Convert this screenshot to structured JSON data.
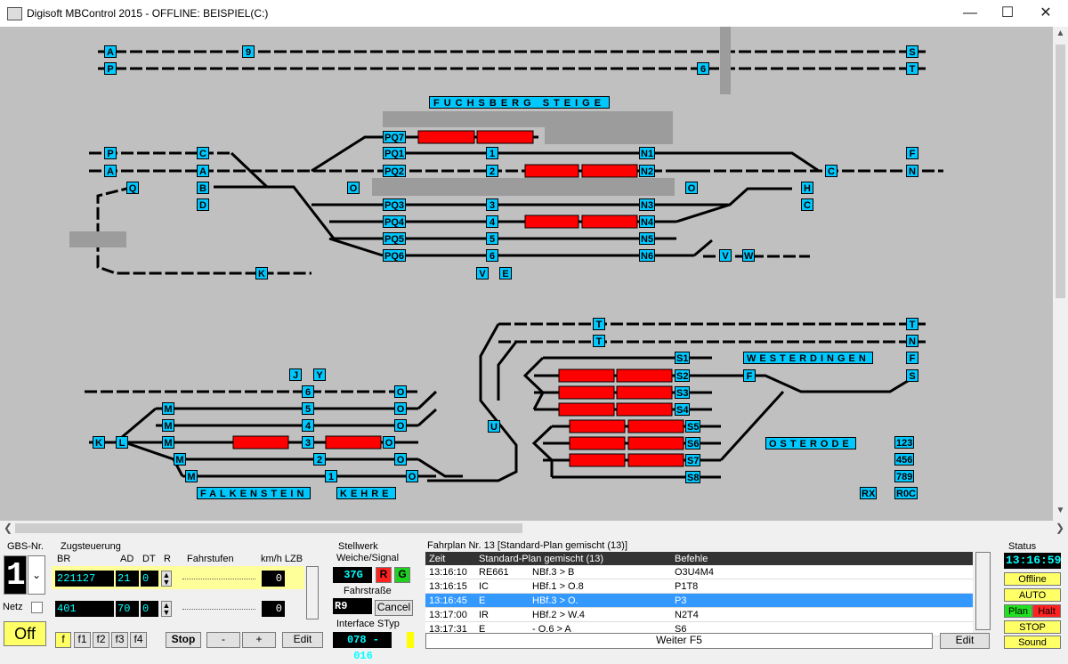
{
  "window": {
    "title": "Digisoft MBControl 2015 - OFFLINE: BEISPIEL(C:)"
  },
  "stations": {
    "s1": "FUCHSBERG STEIGE",
    "s2": "WESTERDINGEN",
    "s3": "OSTERODE",
    "s4": "FALKENSTEIN",
    "s4b": "KEHRE"
  },
  "labels": [
    {
      "id": "A",
      "t": "A"
    },
    {
      "id": "P",
      "t": "P"
    },
    {
      "id": "9",
      "t": "9"
    },
    {
      "id": "6",
      "t": "6"
    },
    {
      "id": "S",
      "t": "S"
    },
    {
      "id": "T",
      "t": "T"
    },
    {
      "id": "P2",
      "t": "P"
    },
    {
      "id": "A2",
      "t": "A"
    },
    {
      "id": "C1",
      "t": "C"
    },
    {
      "id": "A3",
      "t": "A"
    },
    {
      "id": "Q",
      "t": "Q"
    },
    {
      "id": "B",
      "t": "B"
    },
    {
      "id": "D",
      "t": "D"
    },
    {
      "id": "PQ7",
      "t": "PQ7"
    },
    {
      "id": "PQ1",
      "t": "PQ1"
    },
    {
      "id": "PQ2",
      "t": "PQ2"
    },
    {
      "id": "PQ3",
      "t": "PQ3"
    },
    {
      "id": "PQ4",
      "t": "PQ4"
    },
    {
      "id": "PQ5",
      "t": "PQ5"
    },
    {
      "id": "PQ6",
      "t": "PQ6"
    },
    {
      "id": "O1",
      "t": "O"
    },
    {
      "id": "O2",
      "t": "O"
    },
    {
      "id": "N1",
      "t": "N1"
    },
    {
      "id": "N2",
      "t": "N2"
    },
    {
      "id": "N3",
      "t": "N3"
    },
    {
      "id": "N4",
      "t": "N4"
    },
    {
      "id": "N5",
      "t": "N5"
    },
    {
      "id": "N6",
      "t": "N6"
    },
    {
      "id": "n1",
      "t": "1"
    },
    {
      "id": "n2",
      "t": "2"
    },
    {
      "id": "n3",
      "t": "3"
    },
    {
      "id": "n4",
      "t": "4"
    },
    {
      "id": "n5",
      "t": "5"
    },
    {
      "id": "n6",
      "t": "6"
    },
    {
      "id": "F1",
      "t": "F"
    },
    {
      "id": "N",
      "t": "N"
    },
    {
      "id": "C2",
      "t": "C"
    },
    {
      "id": "H",
      "t": "H"
    },
    {
      "id": "C3",
      "t": "C"
    },
    {
      "id": "V",
      "t": "V"
    },
    {
      "id": "W",
      "t": "W"
    },
    {
      "id": "E",
      "t": "E"
    },
    {
      "id": "V2",
      "t": "V"
    },
    {
      "id": "K",
      "t": "K"
    },
    {
      "id": "T2",
      "t": "T"
    },
    {
      "id": "T3",
      "t": "T"
    },
    {
      "id": "T4",
      "t": "T"
    },
    {
      "id": "N7",
      "t": "N"
    },
    {
      "id": "F2",
      "t": "F"
    },
    {
      "id": "S2",
      "t": "S"
    },
    {
      "id": "S_1",
      "t": "S1"
    },
    {
      "id": "S_2",
      "t": "S2"
    },
    {
      "id": "S_3",
      "t": "S3"
    },
    {
      "id": "S_4",
      "t": "S4"
    },
    {
      "id": "S_5",
      "t": "S5"
    },
    {
      "id": "S_6",
      "t": "S6"
    },
    {
      "id": "S_7",
      "t": "S7"
    },
    {
      "id": "S_8",
      "t": "S8"
    },
    {
      "id": "F3",
      "t": "F"
    },
    {
      "id": "U",
      "t": "U"
    },
    {
      "id": "J",
      "t": "J"
    },
    {
      "id": "Y",
      "t": "Y"
    },
    {
      "id": "f6",
      "t": "6"
    },
    {
      "id": "f5",
      "t": "5"
    },
    {
      "id": "f4",
      "t": "4"
    },
    {
      "id": "f3",
      "t": "3"
    },
    {
      "id": "f2",
      "t": "2"
    },
    {
      "id": "f1",
      "t": "1"
    },
    {
      "id": "M1",
      "t": "M"
    },
    {
      "id": "M2",
      "t": "M"
    },
    {
      "id": "M3",
      "t": "M"
    },
    {
      "id": "M4",
      "t": "M"
    },
    {
      "id": "M5",
      "t": "M"
    },
    {
      "id": "Ok1",
      "t": "O"
    },
    {
      "id": "Ok2",
      "t": "O"
    },
    {
      "id": "Ok3",
      "t": "O"
    },
    {
      "id": "Ok4",
      "t": "O"
    },
    {
      "id": "Ok5",
      "t": "O"
    },
    {
      "id": "Ok6",
      "t": "O"
    },
    {
      "id": "K2",
      "t": "K"
    },
    {
      "id": "L",
      "t": "L"
    },
    {
      "id": "k123",
      "t": "123"
    },
    {
      "id": "k456",
      "t": "456"
    },
    {
      "id": "k789",
      "t": "789"
    },
    {
      "id": "kR0C",
      "t": "R0C"
    },
    {
      "id": "kRX",
      "t": "RX"
    }
  ],
  "gbs": {
    "label": "GBS-Nr.",
    "value": "1",
    "netz": "Netz",
    "off": "Off"
  },
  "zug": {
    "label": "Zugsteuerung",
    "headers": {
      "br": "BR",
      "ad": "AD",
      "dt": "DT",
      "r": "R",
      "fs": "Fahrstufen",
      "kmh": "km/h LZB"
    },
    "row1": {
      "br": "221127",
      "ad": "21",
      "dt": "0",
      "kmh": "0"
    },
    "row2": {
      "br": "401",
      "ad": "70",
      "dt": "0",
      "kmh": "0"
    },
    "fbtns": [
      "f",
      "f1",
      "f2",
      "f3",
      "f4"
    ],
    "stop": "Stop",
    "minus": "-",
    "plus": "+",
    "edit": "Edit"
  },
  "stw": {
    "label": "Stellwerk",
    "ws": "Weiche/Signal",
    "code": "37G",
    "r": "R",
    "g": "G",
    "fs": "Fahrstraße",
    "fsval": "R9",
    "cancel": "Cancel",
    "it": "Interface STyp",
    "itval": "078 - 016"
  },
  "fahrplan": {
    "title": "Fahrplan Nr. 13 [Standard-Plan gemischt (13)]",
    "cols": [
      "Zeit",
      "Standard-Plan gemischt (13)",
      "Befehle"
    ],
    "rows": [
      {
        "zeit": "13:16:10",
        "zug": "RE661",
        "route": "NBf.3 > B",
        "bef": "O3U4M4"
      },
      {
        "zeit": "13:16:15",
        "zug": "IC",
        "route": "HBf.1 > O.8",
        "bef": "P1T8"
      },
      {
        "zeit": "13:16:45",
        "zug": "E",
        "route": "HBf.3 > O.",
        "bef": "P3"
      },
      {
        "zeit": "13:17:00",
        "zug": "IR",
        "route": "HBf.2 > W.4",
        "bef": "N2T4"
      },
      {
        "zeit": "13:17:31",
        "zug": "E",
        "route": "- O.6 > A",
        "bef": "S6"
      }
    ],
    "weiter": "Weiter F5",
    "edit": "Edit"
  },
  "status": {
    "label": "Status",
    "clock": "13:16:59",
    "offline": "Offline",
    "auto": "AUTO",
    "plan": "Plan",
    "halt": "Halt",
    "stop": "STOP",
    "sound": "Sound"
  }
}
